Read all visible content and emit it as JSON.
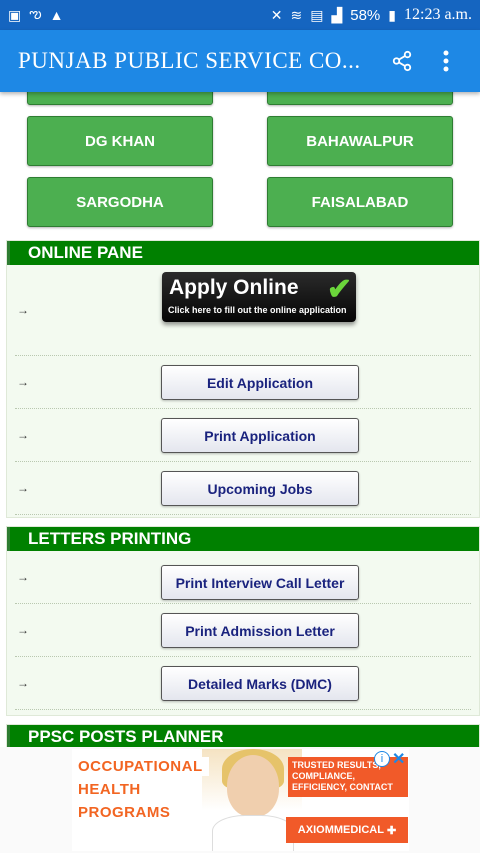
{
  "status_bar": {
    "battery": "58%",
    "time": "12:23 a.m."
  },
  "app_bar": {
    "title": "PUNJAB PUBLIC SERVICE CO...",
    "share_icon": "share-icon",
    "menu_icon": "more-vert-icon"
  },
  "cities": [
    {
      "label": ""
    },
    {
      "label": ""
    },
    {
      "label": "DG KHAN"
    },
    {
      "label": "BAHAWALPUR"
    },
    {
      "label": "SARGODHA"
    },
    {
      "label": "FAISALABAD"
    }
  ],
  "online_pane": {
    "heading": "ONLINE PANE",
    "arrow": "→",
    "apply_online": {
      "title": "Apply Online",
      "subtitle": "Click here to fill out the online application"
    },
    "buttons": [
      "Edit Application",
      "Print Application",
      "Upcoming Jobs"
    ]
  },
  "letters_printing": {
    "heading": "LETTERS PRINTING",
    "buttons": [
      "Print Interview Call Letter",
      "Print Admission Letter",
      "Detailed Marks (DMC)"
    ]
  },
  "planner": {
    "heading": "PPSC POSTS PLANNER"
  },
  "ad": {
    "lines": [
      "OCCUPATIONAL",
      "HEALTH",
      "PROGRAMS"
    ],
    "tagline": "TRUSTED RESULTS, COMPLIANCE, EFFICIENCY, CONTACT",
    "brand": "AXIOMMEDICAL",
    "brand_icon": "plus-cross-icon",
    "info_icon": "info-icon",
    "close_icon": "close-icon"
  },
  "colors": {
    "status_bar": "#1565c0",
    "app_bar": "#1e88e5",
    "city_button": "#4caf50",
    "panel_header": "#008000",
    "ad_accent": "#f15a29"
  }
}
